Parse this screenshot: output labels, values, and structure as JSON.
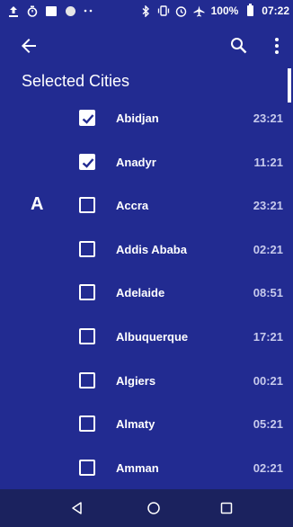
{
  "status_bar": {
    "battery": "100%",
    "time": "07:22",
    "icons": [
      "upload-icon",
      "timer-icon",
      "image-icon",
      "circle-icon",
      "more-dots-icon",
      "bluetooth-icon",
      "vibrate-icon",
      "alarm-icon",
      "airplane-icon",
      "battery-icon"
    ]
  },
  "app_bar": {
    "icons": [
      "arrow-back-icon",
      "search-icon",
      "more-vert-icon"
    ]
  },
  "page": {
    "title": "Selected Cities"
  },
  "section": {
    "letter": "A"
  },
  "cities": [
    {
      "name": "Abidjan",
      "time": "23:21",
      "checked": true
    },
    {
      "name": "Anadyr",
      "time": "11:21",
      "checked": true
    },
    {
      "name": "Accra",
      "time": "23:21",
      "checked": false
    },
    {
      "name": "Addis Ababa",
      "time": "02:21",
      "checked": false
    },
    {
      "name": "Adelaide",
      "time": "08:51",
      "checked": false
    },
    {
      "name": "Albuquerque",
      "time": "17:21",
      "checked": false
    },
    {
      "name": "Algiers",
      "time": "00:21",
      "checked": false
    },
    {
      "name": "Almaty",
      "time": "05:21",
      "checked": false
    },
    {
      "name": "Amman",
      "time": "02:21",
      "checked": false
    }
  ],
  "nav_bar": {
    "icons": [
      "nav-back-icon",
      "nav-home-icon",
      "nav-recents-icon"
    ]
  },
  "colors": {
    "background": "#222b91",
    "nav_bar": "#1b225e",
    "text": "#ffffff",
    "time_text": "#c7caec"
  }
}
